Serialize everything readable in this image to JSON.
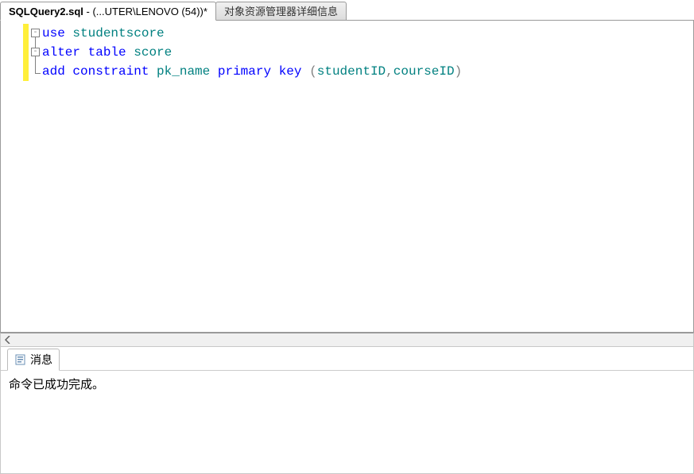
{
  "tabs": {
    "active": {
      "strong": "SQLQuery2.sql",
      "rest": " - (...UTER\\LENOVO (54))*"
    },
    "inactive": "对象资源管理器详细信息"
  },
  "code": {
    "line1": {
      "kw1": "use",
      "ident1": "studentscore"
    },
    "line2": {
      "kw1": "alter",
      "kw2": "table",
      "ident1": "score"
    },
    "line3": {
      "kw1": "add",
      "kw2": "constraint",
      "ident1": "pk_name",
      "kw3": "primary",
      "kw4": "key",
      "open": "(",
      "arg1": "studentID",
      "comma": ",",
      "arg2": "courseID",
      "close": ")"
    }
  },
  "fold": {
    "minus1": "-",
    "minus2": "-"
  },
  "messages": {
    "tab_label": "消息",
    "body": "命令已成功完成。"
  }
}
